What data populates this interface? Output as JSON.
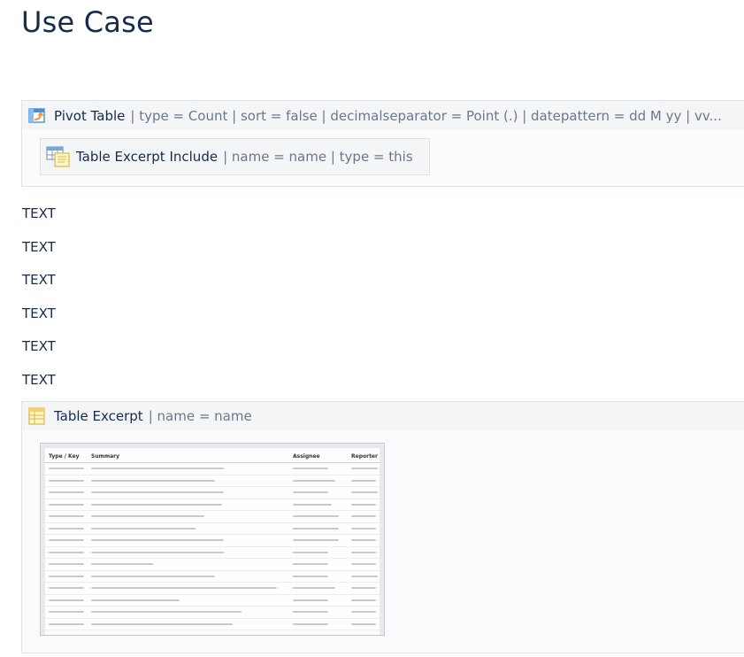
{
  "page": {
    "title": "Use Case"
  },
  "pivot_macro": {
    "name": "Pivot Table",
    "params": "| type = Count | sort = false | decimalseparator = Point (.) | datepattern = dd M yy | vv..."
  },
  "inner_macro": {
    "name": "Table Excerpt Include",
    "params": "| name = name | type = this"
  },
  "text_lines": [
    "TEXT",
    "TEXT",
    "TEXT",
    "TEXT",
    "TEXT",
    "TEXT"
  ],
  "excerpt_macro": {
    "name": "Table Excerpt",
    "params": "| name = name"
  },
  "preview_table": {
    "headers": [
      "Type / Key",
      "Summary",
      "Assignee",
      "Reporter"
    ]
  },
  "colors": {
    "macro_bg": "#f4f5f7",
    "border": "#dfe1e6",
    "param_text": "#6b778c",
    "pivot_icon_accent": "#f79232",
    "pivot_icon_blue": "#4a90d9"
  },
  "icons": {
    "pivot": "pivot-table-icon",
    "include": "table-excerpt-include-icon",
    "excerpt": "table-excerpt-icon"
  }
}
